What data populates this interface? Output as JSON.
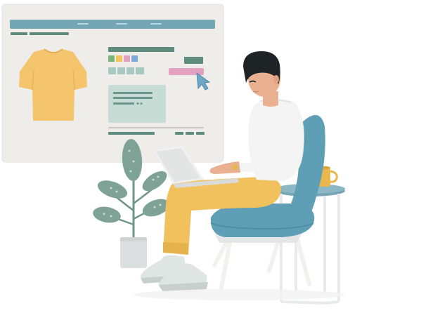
{
  "scene": {
    "colors": {
      "panel": "#efedea",
      "accent_blue": "#74a7b6",
      "bar_green": "#5f8a7e",
      "shirt_yellow": "#f5c56d",
      "pink": "#e2a1c0",
      "chair_teal": "#5e9fb5",
      "pants_yellow": "#f0c15c",
      "tshirt_white": "#f4f4f4",
      "hair_dark": "#1e2326",
      "skin": "#e9b191",
      "plant_green": "#7ea296",
      "pot_gray": "#dcdfe0",
      "table_teal": "#76a6b6",
      "mug_yellow": "#e8b84f"
    },
    "icons": {
      "cursor": "cursor-icon",
      "shirt": "tshirt-icon",
      "laptop": "laptop-icon",
      "mug": "mug-icon",
      "plant": "plant-icon",
      "chair": "chair-icon",
      "side_table": "side-table-icon"
    }
  }
}
